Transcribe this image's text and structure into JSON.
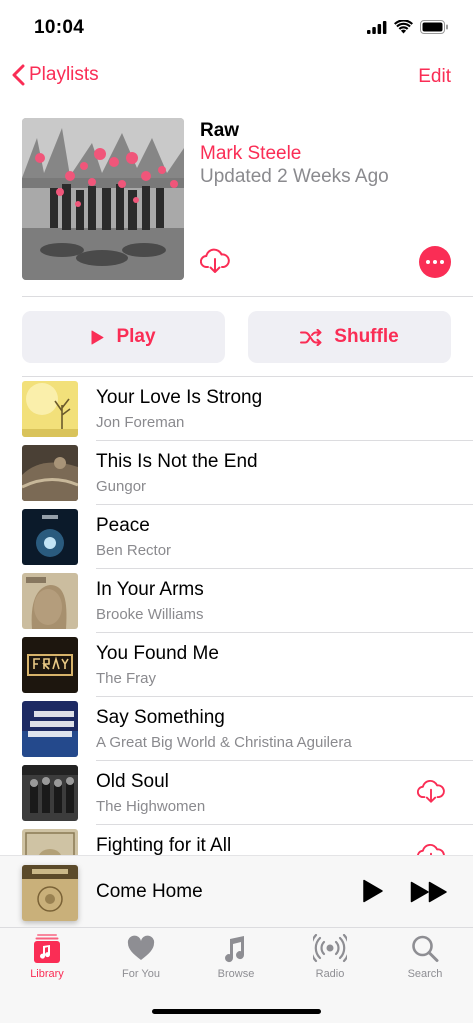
{
  "status": {
    "time": "10:04"
  },
  "nav": {
    "back_label": "Playlists",
    "edit_label": "Edit"
  },
  "playlist": {
    "title": "Raw",
    "curator": "Mark Steele",
    "updated": "Updated 2 Weeks Ago"
  },
  "actions": {
    "play_label": "Play",
    "shuffle_label": "Shuffle"
  },
  "songs": [
    {
      "title": "Your Love Is Strong",
      "artist": "Jon Foreman",
      "downloadable": false
    },
    {
      "title": "This Is Not the End",
      "artist": "Gungor",
      "downloadable": false
    },
    {
      "title": "Peace",
      "artist": "Ben Rector",
      "downloadable": false
    },
    {
      "title": "In Your Arms",
      "artist": "Brooke Williams",
      "downloadable": false
    },
    {
      "title": "You Found Me",
      "artist": "The Fray",
      "downloadable": false
    },
    {
      "title": "Say Something",
      "artist": "A Great Big World & Christina Aguilera",
      "downloadable": false
    },
    {
      "title": "Old Soul",
      "artist": "The Highwomen",
      "downloadable": true
    },
    {
      "title": "Fighting for it All",
      "artist": "",
      "downloadable": true
    }
  ],
  "mini_player": {
    "title": "Come Home"
  },
  "tabs": [
    {
      "label": "Library",
      "icon": "library-icon",
      "active": true
    },
    {
      "label": "For You",
      "icon": "heart-icon",
      "active": false
    },
    {
      "label": "Browse",
      "icon": "music-note-icon",
      "active": false
    },
    {
      "label": "Radio",
      "icon": "radio-broadcast-icon",
      "active": false
    },
    {
      "label": "Search",
      "icon": "search-icon",
      "active": false
    }
  ],
  "colors": {
    "accent": "#fa2d55",
    "secondary_text": "#8a8a8e",
    "tab_inactive": "#8e8e93"
  }
}
